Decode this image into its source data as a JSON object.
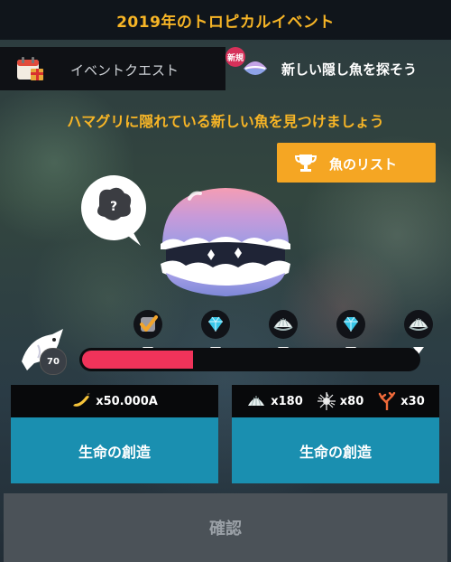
{
  "header": {
    "title": "2019年のトロピカルイベント"
  },
  "tabs": {
    "event_quest": {
      "label": "イベントクエスト",
      "icon": "calendar-gift-icon"
    },
    "hidden_fish": {
      "label": "新しい隠し魚を探そう",
      "badge": "新規",
      "icon": "clam-icon"
    }
  },
  "main": {
    "headline": "ハマグリに隠れている新しい魚を見つけましょう",
    "fish_list_button": "魚のリスト",
    "thought_bubble": "?"
  },
  "progress": {
    "level": "70",
    "fill_fraction": 0.33,
    "milestones": [
      {
        "icon": "checkmark-icon",
        "completed": true
      },
      {
        "icon": "diamond-icon",
        "completed": false
      },
      {
        "icon": "clam-icon",
        "completed": false
      },
      {
        "icon": "diamond-icon",
        "completed": false
      },
      {
        "icon": "clam-icon",
        "completed": false
      }
    ]
  },
  "cards": {
    "left": {
      "costs": [
        {
          "icon": "banana-icon",
          "amount": "x50.000A"
        }
      ],
      "button": "生命の創造"
    },
    "right": {
      "costs": [
        {
          "icon": "shell-icon",
          "amount": "x180"
        },
        {
          "icon": "urchin-icon",
          "amount": "x80"
        },
        {
          "icon": "coral-icon",
          "amount": "x30"
        }
      ],
      "button": "生命の創造"
    }
  },
  "footer": {
    "confirm": "確認"
  },
  "colors": {
    "accent_yellow": "#f7b526",
    "button_orange": "#f5a623",
    "progress_red": "#f0335a",
    "action_blue": "#1a8fb0",
    "confirm_gray": "#4b5258"
  }
}
